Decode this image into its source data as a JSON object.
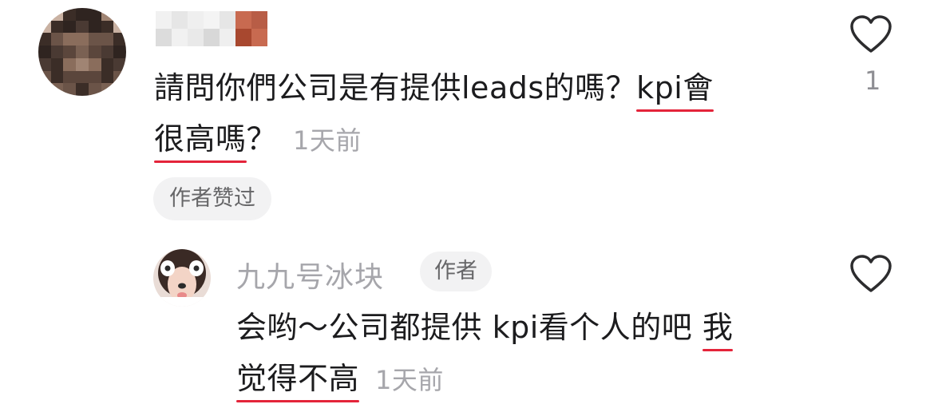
{
  "comment": {
    "text_part1": "請問你們公司是有提供leads的嗎？",
    "text_u1": "kpi會",
    "text_u2": "很高嗎",
    "text_part2": "？",
    "time": "1天前",
    "author_liked": "作者赞过",
    "like_count": "1"
  },
  "reply": {
    "username": "九九号冰块",
    "author_badge": "作者",
    "text_part1": "会哟～公司都提供 kpi看个人的吧 ",
    "text_u1": "我",
    "text_u2": "觉得不高",
    "time": "1天前"
  },
  "icons": {
    "like_top": "heart-outline-icon",
    "like_reply": "heart-outline-icon"
  },
  "colors": {
    "underline": "#e4243a",
    "muted_text": "#a6a6ab"
  }
}
